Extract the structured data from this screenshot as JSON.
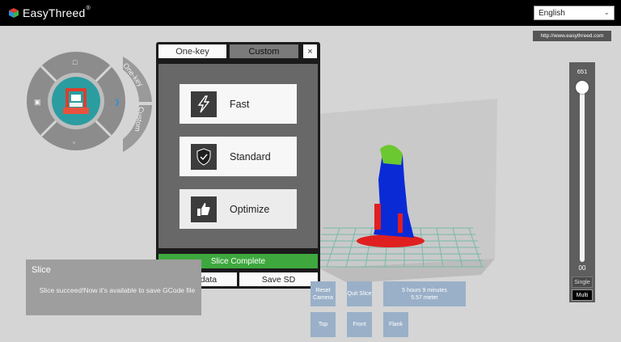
{
  "header": {
    "app_name": "EasyThreed",
    "registered_mark": "®",
    "language": "English"
  },
  "url_tag": "http://www.easythreed.com",
  "radial_menu": {
    "arc_labels": [
      "One-key",
      "Custom"
    ],
    "icons": [
      "file-icon",
      "save-icon",
      "delete-icon",
      "printer-icon"
    ]
  },
  "slice_dialog": {
    "tabs": [
      "One-key",
      "Custom"
    ],
    "close_label": "×",
    "modes": [
      {
        "label": "Fast",
        "icon": "lightning-icon"
      },
      {
        "label": "Standard",
        "icon": "shield-check-icon"
      },
      {
        "label": "Optimize",
        "icon": "thumbs-up-icon"
      }
    ],
    "progress_text": "Slice Complete",
    "progress": 1.0,
    "save_data_label": "Save data",
    "save_sd_label": "Save SD"
  },
  "info_panel": {
    "title": "Slice",
    "message": "Slice succeed!Now it's available to save GCode file"
  },
  "camera_buttons": {
    "reset": "Reset Camera",
    "quit_slice": "Quit Slice",
    "top": "Top",
    "front": "Front",
    "flank": "Flank"
  },
  "print_stats": {
    "time": "5 hours 9 minutes",
    "length": "5.57 meter"
  },
  "layer_slider": {
    "max_value": "651",
    "min_value": "00",
    "single_label": "Single",
    "multi_label": "Multi"
  },
  "colors": {
    "accent_green": "#3ea83e",
    "button_blue": "#9ab0c8",
    "model_blue": "#0a2ad6",
    "model_red": "#e02020",
    "model_green": "#6cc830",
    "brand_teal": "#2b9da1"
  }
}
